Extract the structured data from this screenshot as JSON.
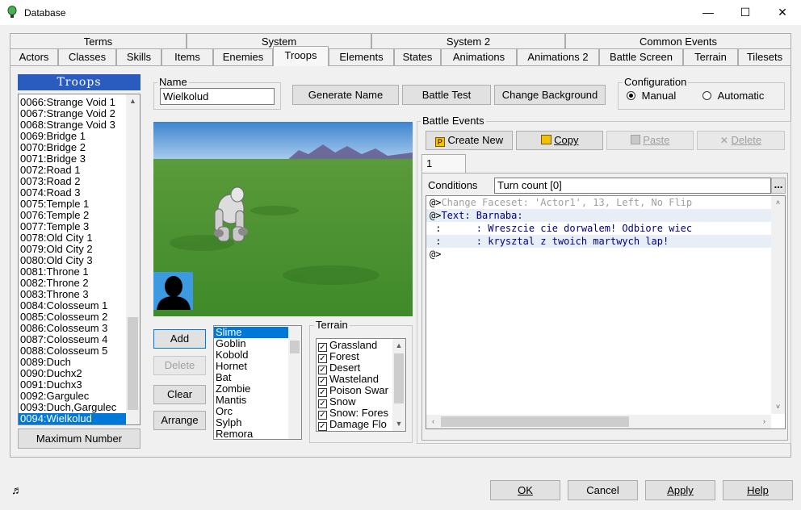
{
  "window": {
    "title": "Database",
    "min": "—",
    "max": "☐",
    "close": "✕"
  },
  "tabs_row1": [
    "Terms",
    "System",
    "System 2",
    "Common Events"
  ],
  "tabs_row2": [
    "Actors",
    "Classes",
    "Skills",
    "Items",
    "Enemies",
    "Troops",
    "Elements",
    "States",
    "Animations",
    "Animations 2",
    "Battle Screen",
    "Terrain",
    "Tilesets"
  ],
  "troops": {
    "header": "Troops",
    "items": [
      "0066:Strange Void 1",
      "0067:Strange Void 2",
      "0068:Strange Void 3",
      "0069:Bridge 1",
      "0070:Bridge 2",
      "0071:Bridge 3",
      "0072:Road 1",
      "0073:Road 2",
      "0074:Road 3",
      "0075:Temple 1",
      "0076:Temple 2",
      "0077:Temple 3",
      "0078:Old City 1",
      "0079:Old City 2",
      "0080:Old City 3",
      "0081:Throne 1",
      "0082:Throne 2",
      "0083:Throne 3",
      "0084:Colosseum 1",
      "0085:Colosseum 2",
      "0086:Colosseum 3",
      "0087:Colosseum 4",
      "0088:Colosseum 5",
      "0089:Duch",
      "0090:Duchx2",
      "0091:Duchx3",
      "0092:Gargulec",
      "0093:Duch,Gargulec",
      "0094:Wielkolud"
    ],
    "selected": "0094:Wielkolud",
    "max_button": "Maximum Number"
  },
  "name": {
    "label": "Name",
    "value": "Wielkolud"
  },
  "buttons": {
    "generate": "Generate Name",
    "battle_test": "Battle Test",
    "change_bg": "Change Background"
  },
  "configuration": {
    "label": "Configuration",
    "manual": "Manual",
    "automatic": "Automatic",
    "selected": "Manual"
  },
  "monster_buttons": {
    "add": "Add",
    "delete": "Delete",
    "clear": "Clear",
    "arrange": "Arrange"
  },
  "monsters": {
    "items": [
      "Slime",
      "Goblin",
      "Kobold",
      "Hornet",
      "Bat",
      "Zombie",
      "Mantis",
      "Orc",
      "Sylph",
      "Remora"
    ],
    "selected": "Slime"
  },
  "terrain": {
    "label": "Terrain",
    "items": [
      "Grassland",
      "Forest",
      "Desert",
      "Wasteland",
      "Poison Swar",
      "Snow",
      "Snow: Fores",
      "Damage Flo"
    ]
  },
  "battle_events": {
    "label": "Battle Events",
    "create_new": "Create New",
    "copy": "Copy",
    "paste": "Paste",
    "delete": "Delete",
    "page_tab": "1",
    "conditions_label": "Conditions",
    "conditions_value": "Turn count [0]",
    "more": "...",
    "lines": [
      {
        "prefix": "@>",
        "text": "Change Faceset: 'Actor1', 13, Left, No Flip",
        "color": "#a0a0a0"
      },
      {
        "prefix": "@>",
        "text": "Text: Barnaba:",
        "color": "#000080"
      },
      {
        "prefix": " :",
        "text": "      : Wreszcie cie dorwalem! Odbiore wiec",
        "color": "#000080"
      },
      {
        "prefix": " :",
        "text": "      : krysztal z twoich martwych lap!",
        "color": "#000080"
      },
      {
        "prefix": "@>",
        "text": "",
        "color": "#000000"
      }
    ]
  },
  "footer": {
    "ok": "OK",
    "cancel": "Cancel",
    "apply": "Apply",
    "help": "Help"
  },
  "colors": {
    "selection": "#0078d7",
    "troops_header": "#2a5cc0",
    "event_text": "#000080"
  }
}
